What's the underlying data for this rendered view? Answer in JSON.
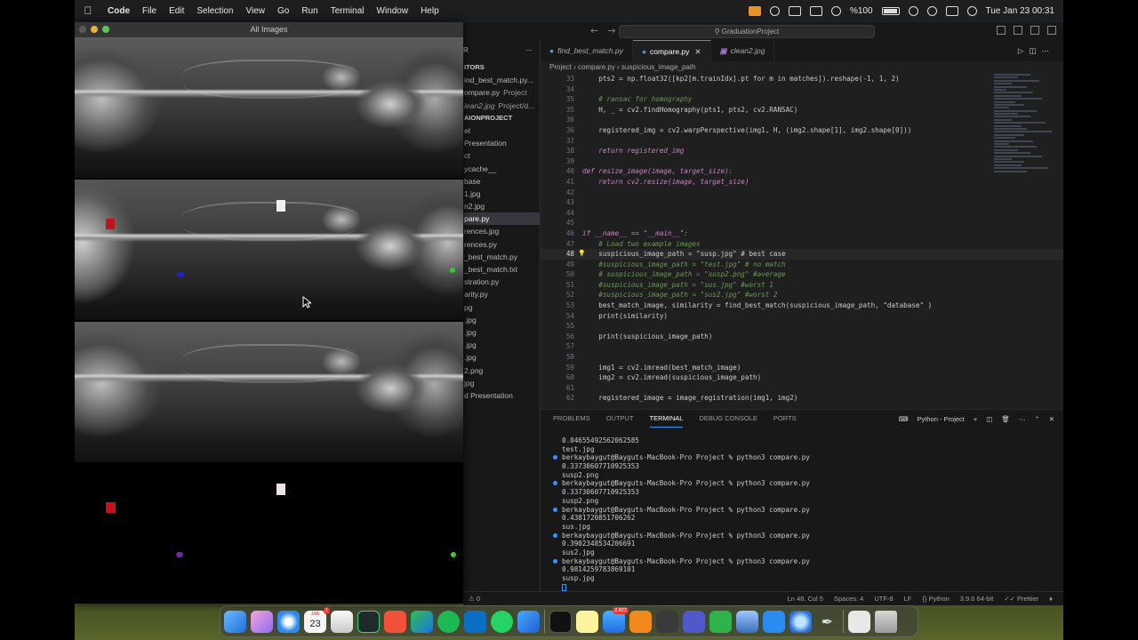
{
  "menubar": {
    "app": "Code",
    "items": [
      "File",
      "Edit",
      "Selection",
      "View",
      "Go",
      "Run",
      "Terminal",
      "Window",
      "Help"
    ],
    "battery": "%100",
    "clock": "Tue Jan 23  00:31"
  },
  "image_window": {
    "title": "All Images"
  },
  "vscode": {
    "search_placeholder": "GraduationProject",
    "tabs": [
      {
        "label": "find_best_match.py"
      },
      {
        "label": "compare.py"
      },
      {
        "label": "clean2.jpg"
      }
    ],
    "breadcrumb": [
      "Project",
      "compare.py",
      "suspicious_image_path"
    ],
    "sidebar": {
      "header": "R",
      "rows": [
        {
          "text": "ITORS"
        },
        {
          "text": "ind_best_match.py..."
        },
        {
          "text": "ompare.py",
          "badge": "Project"
        },
        {
          "text": "lean2.jpg",
          "badge": "Project/d..."
        },
        {
          "text": "AIONPROJECT"
        },
        {
          "text": "et"
        },
        {
          "text": "Presentation"
        },
        {
          "text": "ct"
        },
        {
          "text": "ycache__"
        },
        {
          "text": "base"
        },
        {
          "text": "1.jpg"
        },
        {
          "text": "n2.jpg"
        },
        {
          "text": "pare.py"
        },
        {
          "text": "rences.jpg"
        },
        {
          "text": "rences.py"
        },
        {
          "text": "_best_match.py"
        },
        {
          "text": "_best_match.txt"
        },
        {
          "text": "stration.py"
        },
        {
          "text": "arity.py"
        },
        {
          "text": "pg"
        },
        {
          "text": ".jpg"
        },
        {
          "text": ".jpg"
        },
        {
          "text": ".jpg"
        },
        {
          "text": ".jpg"
        },
        {
          "text": "2.png"
        },
        {
          "text": "jpg"
        },
        {
          "text": "d Presentation"
        }
      ]
    },
    "code": [
      {
        "n": "33",
        "text": "    pts2 = np.float32([kp2[m.trainIdx].pt for m in matches]).reshape(-1, 1, 2)"
      },
      {
        "n": "34",
        "text": ""
      },
      {
        "n": "35",
        "text": "    # ransac for homography"
      },
      {
        "n": "35",
        "text": "    H, _ = cv2.findHomography(pts1, pts2, cv2.RANSAC)"
      },
      {
        "n": "36",
        "text": ""
      },
      {
        "n": "36",
        "text": "    registered_img = cv2.warpPerspective(img1, H, (img2.shape[1], img2.shape[0]))"
      },
      {
        "n": "37",
        "text": ""
      },
      {
        "n": "38",
        "text": "    return registered_img"
      },
      {
        "n": "39",
        "text": ""
      },
      {
        "n": "40",
        "text": "def resize_image(image, target_size):"
      },
      {
        "n": "41",
        "text": "    return cv2.resize(image, target_size)"
      },
      {
        "n": "42",
        "text": ""
      },
      {
        "n": "43",
        "text": ""
      },
      {
        "n": "44",
        "text": ""
      },
      {
        "n": "45",
        "text": ""
      },
      {
        "n": "46",
        "text": "if __name__ == \"__main__\":"
      },
      {
        "n": "47",
        "text": "    # Load two example images"
      },
      {
        "n": "48",
        "text": "    suspicious_image_path = \"susp.jpg\" # best case"
      },
      {
        "n": "49",
        "text": "    #suspicious_image_path = \"test.jpg\" # no match"
      },
      {
        "n": "50",
        "text": "    # suspicious_image_path = \"susp2.png\" #average"
      },
      {
        "n": "51",
        "text": "    #suspicious_image_path = \"sus.jpg\" #worst 1"
      },
      {
        "n": "52",
        "text": "    #suspicious_image_path = \"sus2.jpg\" #worst 2"
      },
      {
        "n": "53",
        "text": "    best_match_image, similarity = find_best_match(suspicious_image_path, \"database\" )"
      },
      {
        "n": "54",
        "text": "    print(similarity)"
      },
      {
        "n": "55",
        "text": ""
      },
      {
        "n": "56",
        "text": "    print(suspicious_image_path)"
      },
      {
        "n": "57",
        "text": ""
      },
      {
        "n": "58",
        "text": ""
      },
      {
        "n": "59",
        "text": "    img1 = cv2.imread(best_match_image)"
      },
      {
        "n": "60",
        "text": "    img2 = cv2.imread(suspicious_image_path)"
      },
      {
        "n": "61",
        "text": ""
      },
      {
        "n": "62",
        "text": "    registered_image = image_registration(img1, img2)"
      }
    ],
    "panel_tabs": [
      "PROBLEMS",
      "OUTPUT",
      "TERMINAL",
      "DEBUG CONSOLE",
      "PORTS"
    ],
    "terminal_name": "Python - Project",
    "terminal": [
      {
        "text": "0.04655492562062585",
        "dot": false
      },
      {
        "text": "test.jpg",
        "dot": false
      },
      {
        "text": "berkaybaygut@Bayguts-MacBook-Pro Project % python3 compare.py",
        "dot": true
      },
      {
        "text": "0.33730607710925353",
        "dot": false
      },
      {
        "text": "susp2.png",
        "dot": false
      },
      {
        "text": "berkaybaygut@Bayguts-MacBook-Pro Project % python3 compare.py",
        "dot": true
      },
      {
        "text": "0.33730607710925353",
        "dot": false
      },
      {
        "text": "susp2.png",
        "dot": false
      },
      {
        "text": "berkaybaygut@Bayguts-MacBook-Pro Project % python3 compare.py",
        "dot": true
      },
      {
        "text": "0.4381720851706262",
        "dot": false
      },
      {
        "text": "sus.jpg",
        "dot": false
      },
      {
        "text": "berkaybaygut@Bayguts-MacBook-Pro Project % python3 compare.py",
        "dot": true
      },
      {
        "text": "0.3902348534206691",
        "dot": false
      },
      {
        "text": "sus2.jpg",
        "dot": false
      },
      {
        "text": "berkaybaygut@Bayguts-MacBook-Pro Project % python3 compare.py",
        "dot": true
      },
      {
        "text": "0.9814259783869101",
        "dot": false
      },
      {
        "text": "susp.jpg",
        "dot": false
      }
    ],
    "status": {
      "left": "0",
      "position": "Ln 48, Col 5",
      "spaces": "Spaces: 4",
      "encoding": "UTF-8",
      "eol": "LF",
      "language": "Python",
      "interpreter": "3.9.6 64-bit",
      "formatter": "Prettier"
    }
  },
  "dock": {
    "calendar_month": "JAN",
    "calendar_day": "23",
    "calendar_badge": "1",
    "mail_badge": "2.822"
  },
  "colors": {
    "accent": "#3794ff",
    "marker_red": "#c0141c",
    "marker_white": "#f0f0f0",
    "marker_blue": "#2222cc",
    "marker_green": "#33cc33"
  }
}
